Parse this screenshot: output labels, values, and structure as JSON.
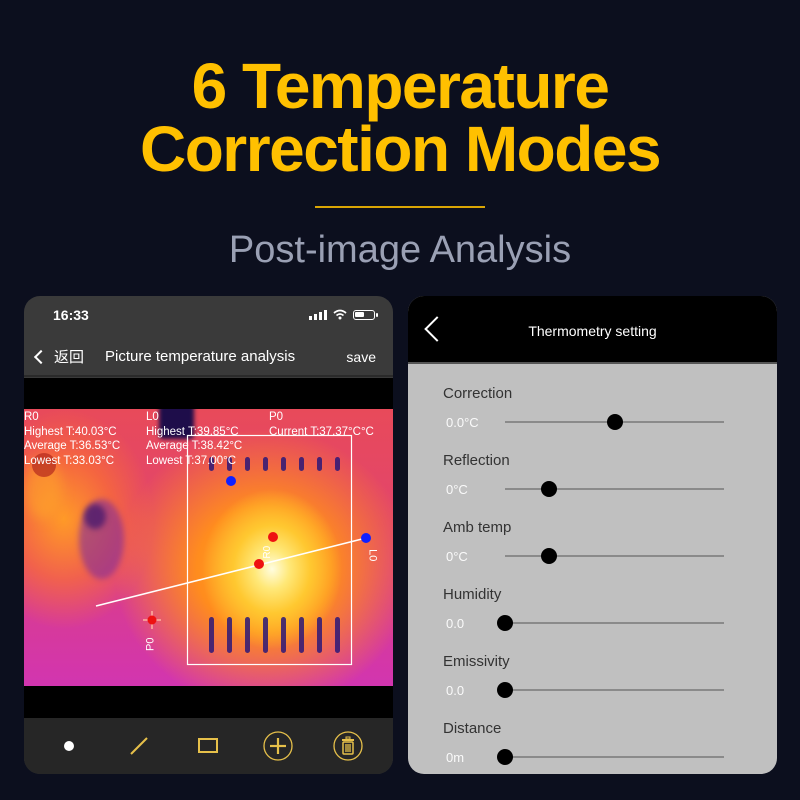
{
  "headline": {
    "line1": "6 Temperature",
    "line2": "Correction Modes",
    "subtitle": "Post-image Analysis",
    "accent_color": "#ffc000"
  },
  "left_phone": {
    "status_bar": {
      "time": "16:33",
      "icons": [
        "cellular-signal-icon",
        "wifi-icon",
        "battery-icon"
      ]
    },
    "nav": {
      "back_label": "返回",
      "title": "Picture temperature analysis",
      "save_label": "save"
    },
    "measurements": {
      "R0": {
        "label": "R0",
        "highest": "Highest T:40.03°C",
        "average": "Average T:36.53°C",
        "lowest": "Lowest T:33.03°C"
      },
      "L0": {
        "label": "L0",
        "highest": "Highest T:39.85°C",
        "average": "Average T:38.42°C",
        "lowest": "Lowest T:37.00°C"
      },
      "P0": {
        "label": "P0",
        "current": "Current T:37.37°C°C"
      }
    },
    "markers": {
      "rect_label": "R0",
      "line_label": "L0",
      "point_label": "P0"
    },
    "toolbar": [
      {
        "name": "point-tool",
        "icon": "dot-icon"
      },
      {
        "name": "line-tool",
        "icon": "line-icon"
      },
      {
        "name": "rectangle-tool",
        "icon": "rectangle-icon"
      },
      {
        "name": "add-tool",
        "icon": "plus-circle-icon"
      },
      {
        "name": "delete-tool",
        "icon": "trash-icon"
      }
    ]
  },
  "right_phone": {
    "title": "Thermometry setting",
    "settings": [
      {
        "label": "Correction",
        "value": "0.0°C",
        "position": 0.5
      },
      {
        "label": "Reflection",
        "value": "0°C",
        "position": 0.2
      },
      {
        "label": "Amb temp",
        "value": "0°C",
        "position": 0.2
      },
      {
        "label": "Humidity",
        "value": "0.0",
        "position": 0.0
      },
      {
        "label": "Emissivity",
        "value": "0.0",
        "position": 0.0
      },
      {
        "label": "Distance",
        "value": "0m",
        "position": 0.0
      }
    ]
  }
}
